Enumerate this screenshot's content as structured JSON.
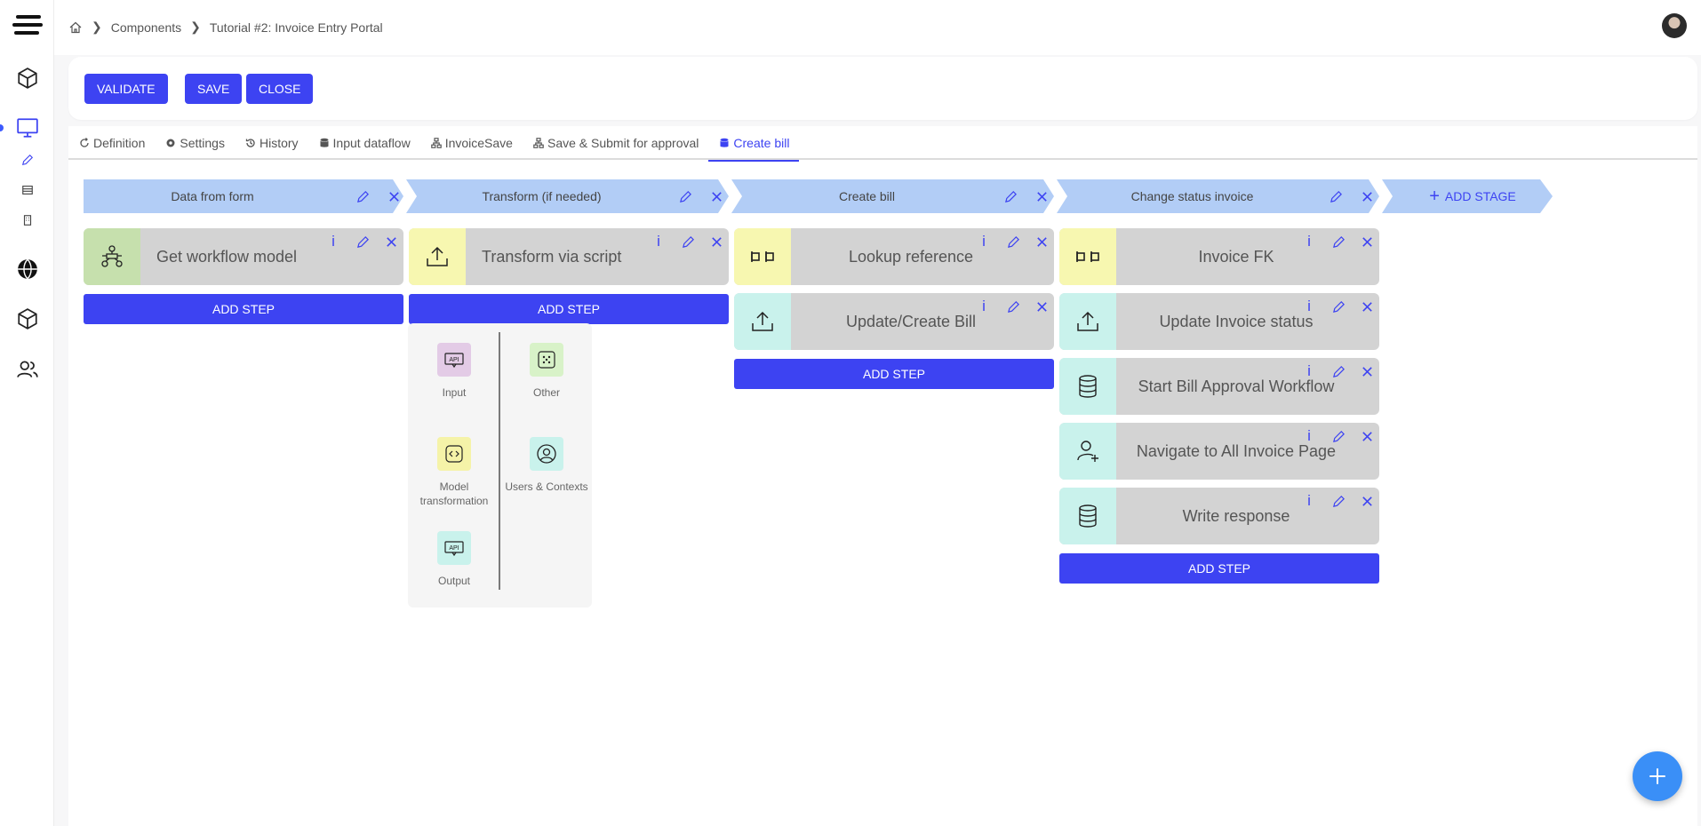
{
  "breadcrumb": [
    "Components",
    "Tutorial #2: Invoice Entry Portal"
  ],
  "actions": {
    "validate": "VALIDATE",
    "save": "SAVE",
    "close": "CLOSE"
  },
  "tabs": [
    {
      "label": "Definition",
      "icon": "loop-icon"
    },
    {
      "label": "Settings",
      "icon": "gear-icon"
    },
    {
      "label": "History",
      "icon": "history-icon"
    },
    {
      "label": "Input dataflow",
      "icon": "database-icon"
    },
    {
      "label": "InvoiceSave",
      "icon": "sitemap-icon"
    },
    {
      "label": "Save & Submit for approval",
      "icon": "sitemap-icon"
    },
    {
      "label": "Create bill",
      "icon": "database-icon",
      "active": true
    }
  ],
  "stages": [
    {
      "label": "Data from form"
    },
    {
      "label": "Transform (if needed)"
    },
    {
      "label": "Create bill"
    },
    {
      "label": "Change status invoice"
    }
  ],
  "add_stage": "ADD STAGE",
  "add_step": "ADD STEP",
  "steps": {
    "s1": [
      {
        "title": "Get workflow model",
        "icon": "workflow-icon",
        "color": "#c6e0ad"
      }
    ],
    "s2": [
      {
        "title": "Transform via script",
        "icon": "upload-icon",
        "color": "#f7f7b0"
      }
    ],
    "s3": [
      {
        "title": "Lookup reference",
        "icon": "lookup-icon",
        "color": "#f7f7b0"
      },
      {
        "title": "Update/Create Bill",
        "icon": "upload-icon",
        "color": "#c9f2ec"
      }
    ],
    "s4": [
      {
        "title": "Invoice FK",
        "icon": "lookup-icon",
        "color": "#f7f7b0"
      },
      {
        "title": "Update Invoice status",
        "icon": "upload-icon",
        "color": "#c9f2ec"
      },
      {
        "title": "Start Bill Approval Workflow",
        "icon": "database-icon",
        "color": "#c9f2ec"
      },
      {
        "title": "Navigate to All Invoice Page",
        "icon": "add-user-icon",
        "color": "#c9f2ec"
      },
      {
        "title": "Write response",
        "icon": "database-icon",
        "color": "#c9f2ec"
      }
    ]
  },
  "step_menu": [
    {
      "label": "Input",
      "icon": "api-icon",
      "color": "#e3cbe6"
    },
    {
      "label": "Other",
      "icon": "dots-icon",
      "color": "#d8f2c8"
    },
    {
      "label": "Model transformation",
      "icon": "code-frame-icon",
      "color": "#f5f3a8"
    },
    {
      "label": "Users & Contexts",
      "icon": "user-circle-icon",
      "color": "#c9f2ec"
    },
    {
      "label": "Output",
      "icon": "api-icon",
      "color": "#c9f2ec"
    }
  ],
  "icon_actions": {
    "info": "i"
  },
  "colors": {
    "accent": "#3d43f2",
    "stage": "#b2cdf6",
    "card": "#d3d3d3",
    "fab": "#3a8ff7"
  }
}
